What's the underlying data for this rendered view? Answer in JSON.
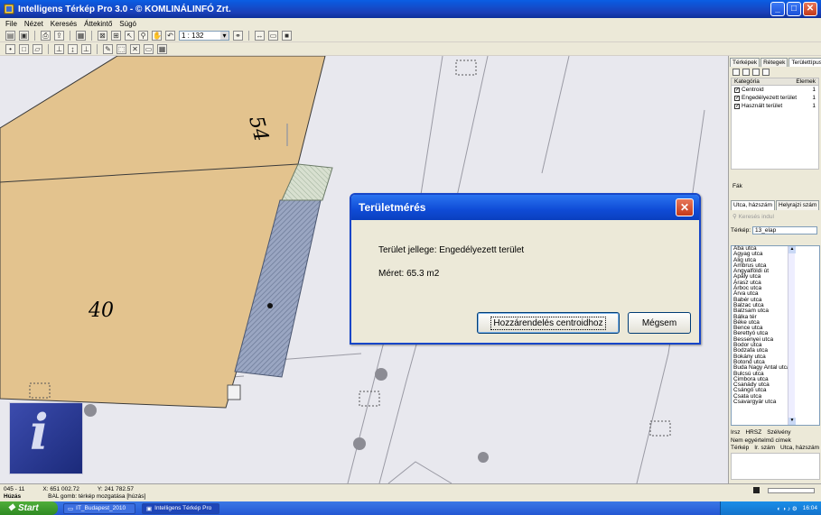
{
  "window": {
    "title": "Intelligens Térkép Pro 3.0 - © KOMLINÁLINFÓ Zrt."
  },
  "menu": [
    "File",
    "Nézet",
    "Keresés",
    "Áttekintő",
    "Súgó"
  ],
  "toolbar": {
    "zoom_value": "1 : 132"
  },
  "map": {
    "labels": {
      "parcel_54": "54",
      "parcel_40": "40"
    },
    "colors": {
      "parcel_fill": "#e3c38e",
      "background": "#e8e8ee",
      "measure_fill": "#99a8c0"
    }
  },
  "dialog": {
    "title": "Területmérés",
    "line_type": "Terület jellege: Engedélyezett terület",
    "line_size": "Méret: 65.3 m2",
    "assign_button": "Hozzárendelés centroidhoz",
    "cancel_button": "Mégsem"
  },
  "panel": {
    "tabs": [
      "Térképek",
      "Rétegek",
      "Területtípusok"
    ],
    "layer_header": [
      "Kategória",
      "Elemek"
    ],
    "layers": [
      {
        "label": "Centroid",
        "count": "1"
      },
      {
        "label": "Engedélyezett terület",
        "count": "1"
      },
      {
        "label": "Használt terület",
        "count": "1"
      }
    ],
    "fa_label": "Fák",
    "search_tabs": [
      "Utca, házszám",
      "Helyrajzi szám"
    ],
    "search_placeholder": "Keresés indul",
    "terkep_label": "Térkép:",
    "terkep_value": "13_elap",
    "streets": [
      "Aba utca",
      "Agyag utca",
      "Alig utca",
      "Ambrus utca",
      "Angyalföldi út",
      "Apály utca",
      "Árasz utca",
      "Árboc utca",
      "Árva utca",
      "Babér utca",
      "Balzac utca",
      "Balzsam utca",
      "Bálka tér",
      "Béke utca",
      "Bence utca",
      "Berettyó utca",
      "Bessenyei utca",
      "Bodor utca",
      "Bodzafa utca",
      "Bokány utca",
      "Botond utca",
      "Buda Nagy Antal utca",
      "Bulcsú utca",
      "Cimbora utca",
      "Csanády utca",
      "Csángó utca",
      "Csata utca",
      "Csavargyár utca"
    ],
    "bottom_tabs": [
      "Irsz",
      "HRSZ",
      "Szélvény"
    ],
    "bottom_note": "Nem egyértelmű címek",
    "bottom_cols": [
      "Térkép",
      "Ir. szám",
      "Utca, házszám"
    ]
  },
  "status": {
    "code": "045 - 11",
    "x": "X: 651 002.72",
    "y": "Y: 241 782.57",
    "mode": "Húzás",
    "hint": "BAL gomb: térkép mozgatása [húzás]"
  },
  "taskbar": {
    "start": "Start",
    "item1": "IT_Budapest_2010",
    "item2": "Intelligens Térkép Pro",
    "clock": "16:04"
  }
}
